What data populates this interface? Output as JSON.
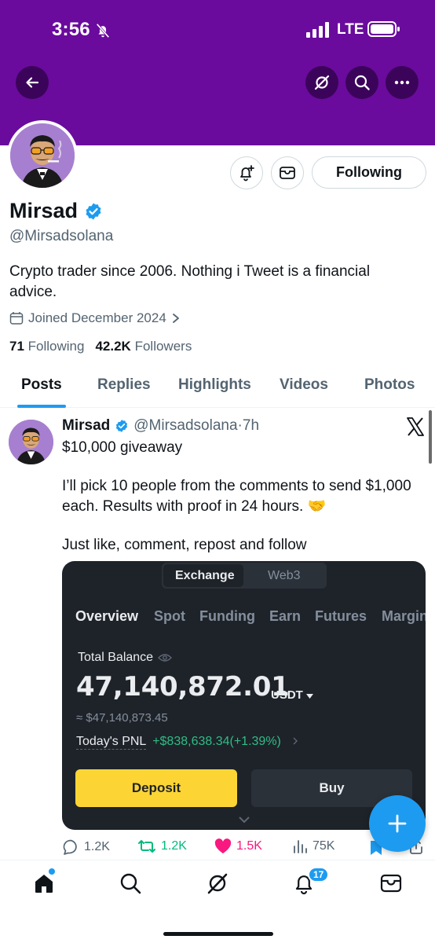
{
  "status_bar": {
    "time": "3:56",
    "network": "LTE"
  },
  "profile": {
    "display_name": "Mirsad",
    "handle": "@Mirsadsolana",
    "bio": "Crypto trader since 2006. Nothing i Tweet is a financial advice.",
    "joined": "Joined December 2024",
    "following_count": "71",
    "following_label": "Following",
    "followers_count": "42.2K",
    "followers_label": "Followers",
    "follow_button_label": "Following",
    "verified": true
  },
  "tabs": [
    {
      "label": "Posts",
      "active": true
    },
    {
      "label": "Replies",
      "active": false
    },
    {
      "label": "Highlights",
      "active": false
    },
    {
      "label": "Videos",
      "active": false
    },
    {
      "label": "Photos",
      "active": false
    }
  ],
  "post": {
    "author_name": "Mirsad",
    "author_handle": "@Mirsadsolana",
    "separator": "·",
    "time": "7h",
    "line1": "$10,000 giveaway",
    "line2": "I’ll pick 10 people from the comments to send $1,000 each. Results with proof in 24 hours. 🤝",
    "line3": "Just like, comment, repost and follow",
    "media": {
      "segment_active": "Exchange",
      "segment_other": "Web3",
      "nav": [
        "Overview",
        "Spot",
        "Funding",
        "Earn",
        "Futures",
        "Margin"
      ],
      "total_balance_label": "Total Balance",
      "total_balance": "47,140,872.01",
      "currency": "USDT",
      "approx": "≈ $47,140,873.45",
      "pnl_label": "Today's PNL",
      "pnl_value": "+$838,638.34(+1.39%)",
      "deposit_label": "Deposit",
      "buy_label": "Buy"
    },
    "engagement": {
      "replies": "1.2K",
      "reposts": "1.2K",
      "likes": "1.5K",
      "views": "75K"
    }
  },
  "bottom_nav": {
    "notifications_badge": "17"
  },
  "colors": {
    "banner": "#6a0b9d",
    "accent": "#1d9bf0",
    "like": "#f91880",
    "repost": "#00ba7c",
    "binance_yellow": "#fcd535",
    "pnl_green": "#2ebd85"
  }
}
